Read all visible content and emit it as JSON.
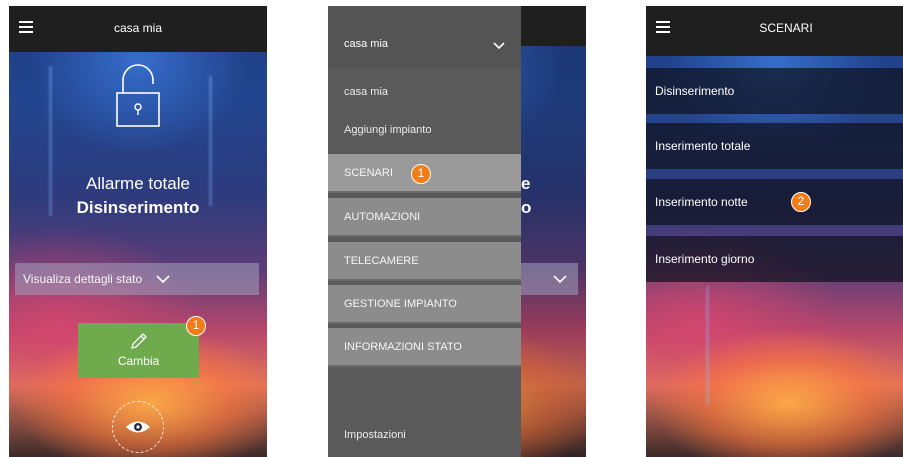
{
  "screen1": {
    "topbar_title": "casa mia",
    "alarm_title": "Allarme totale",
    "alarm_state": "Disinserimento",
    "status_details_label": "Visualiza dettagli stato",
    "change_button_label": "Cambia",
    "badge": "1"
  },
  "screen2": {
    "header_label": "casa mia",
    "plant_name": "casa mia",
    "add_plant": "Aggiungi impianto",
    "menu_items": [
      "SCENARI",
      "AUTOMAZIONI",
      "TELECAMERE",
      "GESTIONE IMPIANTO",
      "INFORMAZIONI STATO"
    ],
    "settings": "Impostazioni",
    "badge": "1"
  },
  "screen3": {
    "topbar_title": "SCENARI",
    "scenarios": [
      "Disinserimento",
      "Inserimento totale",
      "Inserimento notte",
      "Inserimento giorno"
    ],
    "badge": "2"
  },
  "colors": {
    "topbar": "#1f1f1f",
    "accent_green": "#6faa4c",
    "badge_orange": "#f07d18",
    "drawer_bg": "#5a5a5a",
    "drawer_item": "#8c8c8c"
  },
  "icons": [
    "hamburger-icon",
    "lock-open-icon",
    "chevron-down-icon",
    "pencil-icon",
    "eye-icon"
  ]
}
